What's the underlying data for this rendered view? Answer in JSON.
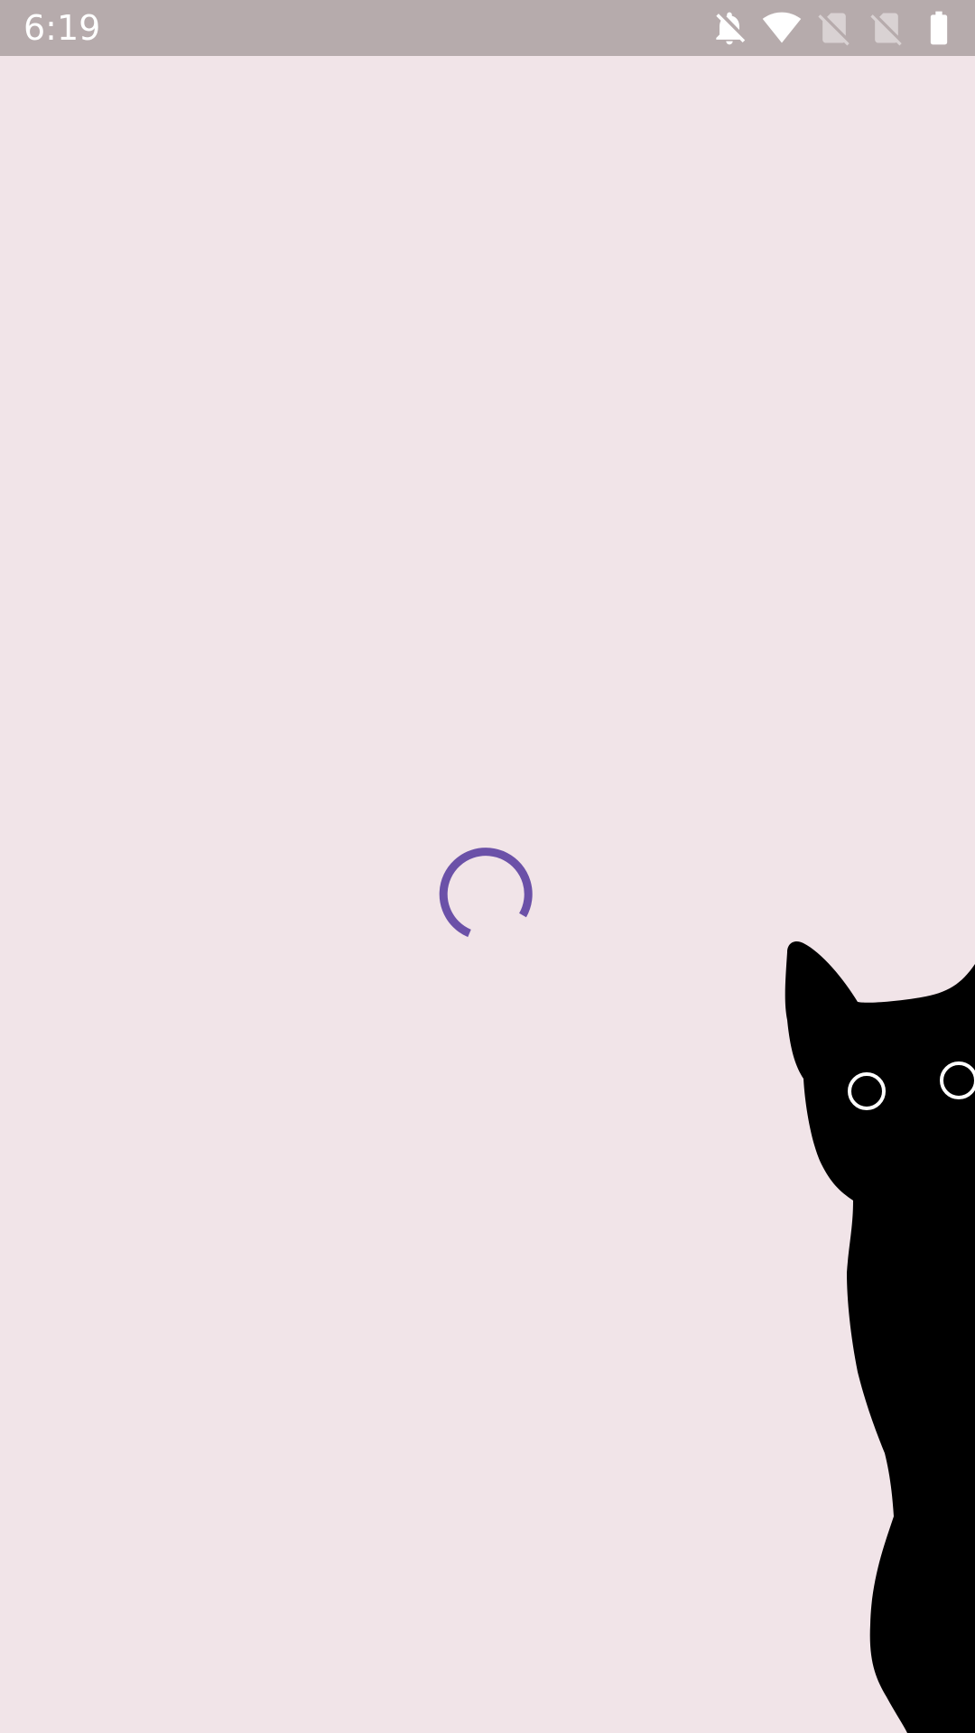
{
  "status_bar": {
    "time": "6:19",
    "icons": [
      "notifications-off-icon",
      "wifi-icon",
      "no-sim-icon",
      "no-sim-icon",
      "battery-icon"
    ],
    "background": "#b6abac"
  },
  "screen": {
    "background": "#f1e4e8",
    "loading_indicator": {
      "icon": "progress-spinner-icon",
      "color": "#6b51a8"
    },
    "illustration": {
      "icon": "black-cat-icon",
      "color": "#000000"
    }
  }
}
